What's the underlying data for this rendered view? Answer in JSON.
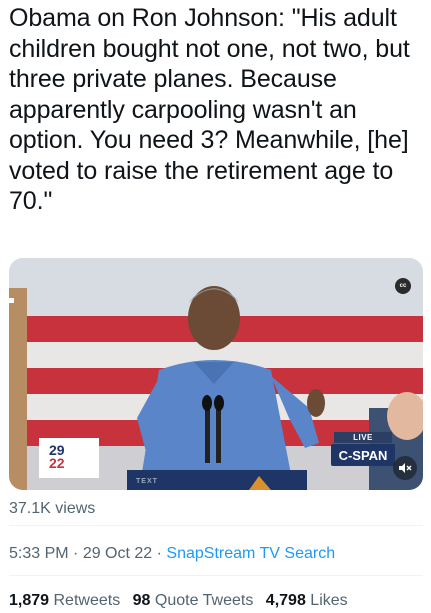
{
  "tweet": {
    "text": "Obama on Ron Johnson: \"His adult children bought not one, not two, but three private planes. Because apparently carpooling wasn't an option. You need 3? Meanwhile, [he] voted to raise the retirement age to 70.\""
  },
  "video": {
    "cc_label": "cc",
    "live_label": "LIVE",
    "network_logo": "C-SPAN",
    "podium_label": "TEXT",
    "event_logo_top": "29",
    "event_logo_bottom": "22",
    "mute_icon": "speaker-muted-icon"
  },
  "views": "37.1K views",
  "meta": {
    "time": "5:33 PM",
    "separator1": " · ",
    "date": "29 Oct 22",
    "separator2": " · ",
    "source": "SnapStream TV Search"
  },
  "stats": {
    "retweets_count": "1,879",
    "retweets_label": "Retweets",
    "quotes_count": "98",
    "quotes_label": "Quote Tweets",
    "likes_count": "4,798",
    "likes_label": "Likes"
  },
  "colors": {
    "link": "#1d9bf0",
    "secondary_text": "#536471",
    "primary_text": "#0f1419"
  }
}
